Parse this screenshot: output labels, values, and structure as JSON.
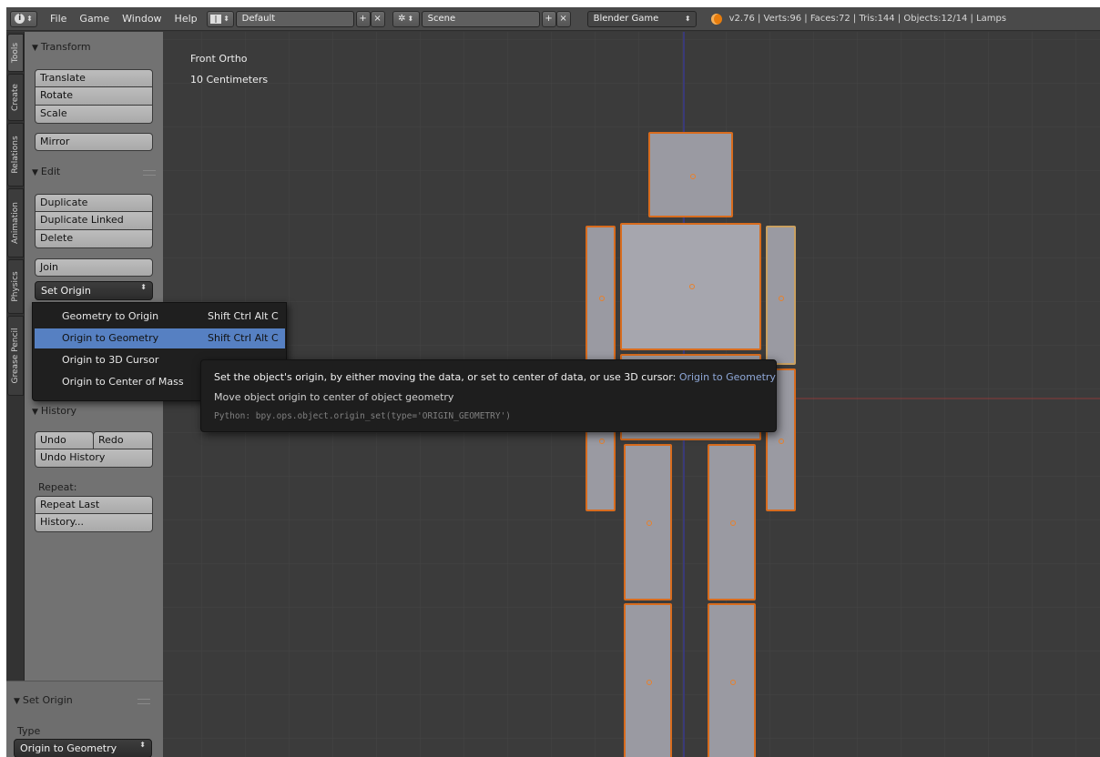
{
  "header": {
    "menus": [
      "File",
      "Game",
      "Window",
      "Help"
    ],
    "layout_value": "Default",
    "scene_value": "Scene",
    "engine_value": "Blender Game",
    "stats": "v2.76 | Verts:96 | Faces:72 | Tris:144 | Objects:12/14 | Lamps"
  },
  "tabs": [
    "Tools",
    "Create",
    "Relations",
    "Animation",
    "Physics",
    "Grease Pencil"
  ],
  "toolshelf": {
    "transform_title": "Transform",
    "translate": "Translate",
    "rotate": "Rotate",
    "scale": "Scale",
    "mirror": "Mirror",
    "edit_title": "Edit",
    "duplicate": "Duplicate",
    "duplicate_linked": "Duplicate Linked",
    "delete": "Delete",
    "join": "Join",
    "set_origin": "Set Origin",
    "history_title": "History",
    "undo": "Undo",
    "redo": "Redo",
    "undo_history": "Undo History",
    "repeat_label": "Repeat:",
    "repeat_last": "Repeat Last",
    "history_btn": "History..."
  },
  "operator_panel": {
    "title": "Set Origin",
    "type_label": "Type",
    "type_value": "Origin to Geometry"
  },
  "viewport": {
    "view_name": "Front Ortho",
    "scale_text": "10 Centimeters"
  },
  "set_origin_menu": {
    "items": [
      {
        "label": "Geometry to Origin",
        "shortcut": "Shift Ctrl Alt C"
      },
      {
        "label": "Origin to Geometry",
        "shortcut": "Shift Ctrl Alt C"
      },
      {
        "label": "Origin to 3D Cursor",
        "shortcut": ""
      },
      {
        "label": "Origin to Center of Mass",
        "shortcut": ""
      }
    ],
    "highlighted_index": 1
  },
  "tooltip": {
    "line1": "Set the object's origin, by either moving the data, or set to center of data, or use 3D cursor:",
    "line1_value": "Origin to Geometry",
    "line2": "Move object origin to center of object geometry",
    "python": "Python: bpy.ops.object.origin_set(type='ORIGIN_GEOMETRY')"
  },
  "colors": {
    "selection_outline": "#d86c1e",
    "menu_highlight": "#5680c2",
    "tooltip_value": "#8fa8d8"
  }
}
